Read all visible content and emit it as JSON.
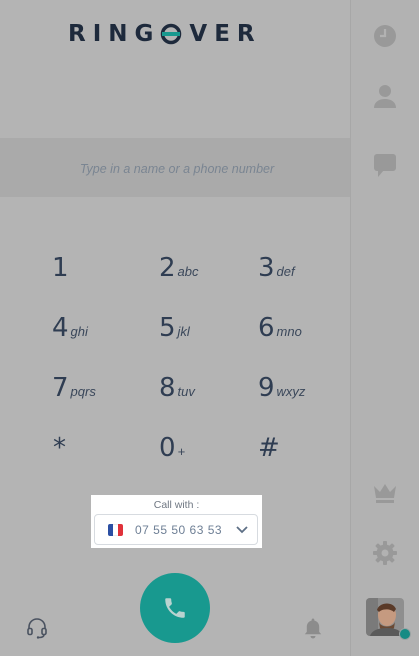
{
  "brand": {
    "logo_text_left": "RING",
    "logo_text_right": "VER",
    "accent": "#18998f"
  },
  "search": {
    "placeholder": "Type in a name or a phone number"
  },
  "keypad": [
    {
      "digit": "1",
      "letters": ""
    },
    {
      "digit": "2",
      "letters": "abc"
    },
    {
      "digit": "3",
      "letters": "def"
    },
    {
      "digit": "4",
      "letters": "ghi"
    },
    {
      "digit": "5",
      "letters": "jkl"
    },
    {
      "digit": "6",
      "letters": "mno"
    },
    {
      "digit": "7",
      "letters": "pqrs"
    },
    {
      "digit": "8",
      "letters": "tuv"
    },
    {
      "digit": "9",
      "letters": "wxyz"
    },
    {
      "digit": "*",
      "letters": ""
    },
    {
      "digit": "0",
      "letters": "+"
    },
    {
      "digit": "#",
      "letters": ""
    }
  ],
  "call_with": {
    "label": "Call with :",
    "number": "07 55 50 63 53",
    "flag": "france-flag-icon"
  },
  "call_button": {
    "icon": "phone-icon",
    "color": "#18998f"
  },
  "bottom_icons": {
    "left": "headset-icon",
    "right": "bell-icon"
  },
  "sidebar": {
    "items": [
      {
        "icon": "clock-icon"
      },
      {
        "icon": "contact-icon"
      },
      {
        "icon": "chat-icon"
      },
      {
        "icon": "crown-icon"
      },
      {
        "icon": "gear-icon"
      }
    ],
    "status_color": "#178b84"
  }
}
